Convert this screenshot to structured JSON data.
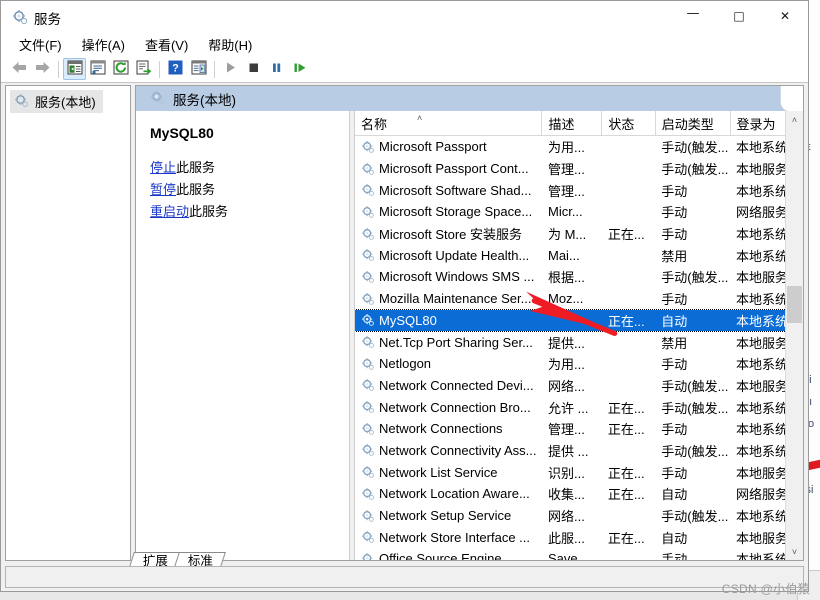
{
  "window": {
    "title": "服务",
    "icon": "services-gear-icon",
    "minimize_label": "—",
    "maximize_label": "□",
    "close_label": "✕"
  },
  "menubar": {
    "items": [
      {
        "label": "文件(F)",
        "name": "menu-file"
      },
      {
        "label": "操作(A)",
        "name": "menu-action"
      },
      {
        "label": "查看(V)",
        "name": "menu-view"
      },
      {
        "label": "帮助(H)",
        "name": "menu-help"
      }
    ]
  },
  "toolbar": {
    "buttons": [
      {
        "name": "back-button",
        "icon": "arrow-left-icon"
      },
      {
        "name": "forward-button",
        "icon": "arrow-right-icon"
      },
      {
        "name": "show-hide-tree-button",
        "icon": "console-tree-icon",
        "active": true
      },
      {
        "name": "properties-button",
        "icon": "properties-icon"
      },
      {
        "name": "refresh-button",
        "icon": "refresh-icon"
      },
      {
        "name": "export-list-button",
        "icon": "export-list-icon"
      },
      {
        "name": "help-button",
        "icon": "help-question-icon"
      },
      {
        "name": "show-action-pane-button",
        "icon": "action-pane-icon"
      },
      {
        "name": "start-service-button",
        "icon": "play-icon"
      },
      {
        "name": "stop-service-button",
        "icon": "stop-icon"
      },
      {
        "name": "pause-service-button",
        "icon": "pause-icon"
      },
      {
        "name": "restart-service-button",
        "icon": "restart-icon"
      }
    ]
  },
  "tree": {
    "root_label": "服务(本地)",
    "root_icon": "services-gear-icon"
  },
  "list_header": {
    "label": "服务(本地)",
    "icon": "services-gear-icon"
  },
  "details": {
    "service_name": "MySQL80",
    "links": [
      {
        "name": "stop-service-link",
        "link_text": "停止",
        "suffix": "此服务"
      },
      {
        "name": "pause-service-link",
        "link_text": "暂停",
        "suffix": "此服务"
      },
      {
        "name": "restart-service-link",
        "link_text": "重启动",
        "suffix": "此服务"
      }
    ]
  },
  "table": {
    "columns": [
      "名称",
      "描述",
      "状态",
      "启动类型",
      "登录为"
    ],
    "sort_column": "名称",
    "sort_direction": "asc",
    "rows": [
      {
        "name": "Microsoft Passport",
        "desc": "为用...",
        "state": "",
        "start": "手动(触发...",
        "logon": "本地系统",
        "selected": false
      },
      {
        "name": "Microsoft Passport Cont...",
        "desc": "管理...",
        "state": "",
        "start": "手动(触发...",
        "logon": "本地服务",
        "selected": false
      },
      {
        "name": "Microsoft Software Shad...",
        "desc": "管理...",
        "state": "",
        "start": "手动",
        "logon": "本地系统",
        "selected": false
      },
      {
        "name": "Microsoft Storage Space...",
        "desc": "Micr...",
        "state": "",
        "start": "手动",
        "logon": "网络服务",
        "selected": false
      },
      {
        "name": "Microsoft Store 安装服务",
        "desc": "为 M...",
        "state": "正在...",
        "start": "手动",
        "logon": "本地系统",
        "selected": false
      },
      {
        "name": "Microsoft Update Health...",
        "desc": "Mai...",
        "state": "",
        "start": "禁用",
        "logon": "本地系统",
        "selected": false
      },
      {
        "name": "Microsoft Windows SMS ...",
        "desc": "根据...",
        "state": "",
        "start": "手动(触发...",
        "logon": "本地服务",
        "selected": false
      },
      {
        "name": "Mozilla Maintenance Ser...",
        "desc": "Moz...",
        "state": "",
        "start": "手动",
        "logon": "本地系统",
        "selected": false
      },
      {
        "name": "MySQL80",
        "desc": "",
        "state": "正在...",
        "start": "自动",
        "logon": "本地系统",
        "selected": true
      },
      {
        "name": "Net.Tcp Port Sharing Ser...",
        "desc": "提供...",
        "state": "",
        "start": "禁用",
        "logon": "本地服务",
        "selected": false
      },
      {
        "name": "Netlogon",
        "desc": "为用...",
        "state": "",
        "start": "手动",
        "logon": "本地系统",
        "selected": false
      },
      {
        "name": "Network Connected Devi...",
        "desc": "网络...",
        "state": "",
        "start": "手动(触发...",
        "logon": "本地服务",
        "selected": false
      },
      {
        "name": "Network Connection Bro...",
        "desc": "允许 ...",
        "state": "正在...",
        "start": "手动(触发...",
        "logon": "本地系统",
        "selected": false
      },
      {
        "name": "Network Connections",
        "desc": "管理...",
        "state": "正在...",
        "start": "手动",
        "logon": "本地系统",
        "selected": false
      },
      {
        "name": "Network Connectivity Ass...",
        "desc": "提供 ...",
        "state": "",
        "start": "手动(触发...",
        "logon": "本地系统",
        "selected": false
      },
      {
        "name": "Network List Service",
        "desc": "识别...",
        "state": "正在...",
        "start": "手动",
        "logon": "本地服务",
        "selected": false
      },
      {
        "name": "Network Location Aware...",
        "desc": "收集...",
        "state": "正在...",
        "start": "自动",
        "logon": "网络服务",
        "selected": false
      },
      {
        "name": "Network Setup Service",
        "desc": "网络...",
        "state": "",
        "start": "手动(触发...",
        "logon": "本地系统",
        "selected": false
      },
      {
        "name": "Network Store Interface ...",
        "desc": "此服...",
        "state": "正在...",
        "start": "自动",
        "logon": "本地服务",
        "selected": false
      },
      {
        "name": "Office Source Engine",
        "desc": "Save",
        "state": "",
        "start": "手动",
        "logon": "本地系统",
        "selected": false
      }
    ]
  },
  "tabs": [
    {
      "label": "扩展",
      "name": "tab-extended",
      "active": false
    },
    {
      "label": "标准",
      "name": "tab-standard",
      "active": true
    }
  ],
  "scrollbar": {
    "up_arrow": "˄",
    "down_arrow": "˅"
  },
  "watermark": "CSDN @小伯猿",
  "colors": {
    "selection": "#0a6cd4",
    "header_band": "#b8cce4",
    "link": "#1a38c8",
    "annotation_arrow": "#ee1c25"
  }
}
